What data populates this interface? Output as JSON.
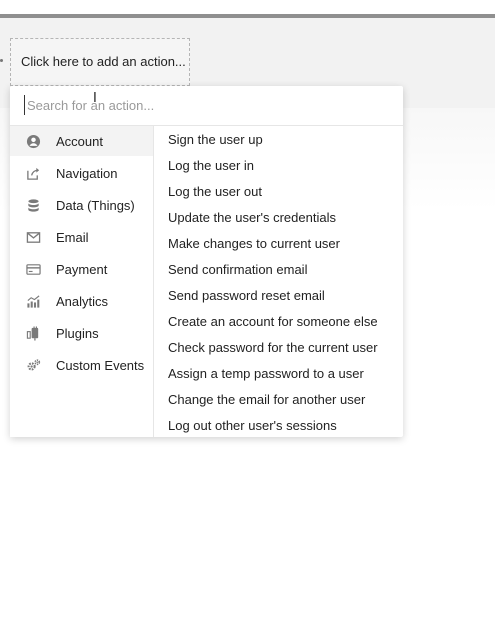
{
  "action_box": {
    "label": "Click here to add an action..."
  },
  "search": {
    "placeholder": "Search for an action...",
    "value": ""
  },
  "categories": [
    {
      "label": "Account",
      "icon": "account-icon",
      "active": true
    },
    {
      "label": "Navigation",
      "icon": "navigation-icon",
      "active": false
    },
    {
      "label": "Data (Things)",
      "icon": "database-icon",
      "active": false
    },
    {
      "label": "Email",
      "icon": "email-icon",
      "active": false
    },
    {
      "label": "Payment",
      "icon": "payment-icon",
      "active": false
    },
    {
      "label": "Analytics",
      "icon": "analytics-icon",
      "active": false
    },
    {
      "label": "Plugins",
      "icon": "plugins-icon",
      "active": false
    },
    {
      "label": "Custom Events",
      "icon": "custom-events-icon",
      "active": false
    }
  ],
  "actions": [
    "Sign the user up",
    "Log the user in",
    "Log the user out",
    "Update the user's credentials",
    "Make changes to current user",
    "Send confirmation email",
    "Send password reset email",
    "Create an account for someone else",
    "Check password for the current user",
    "Assign a temp password to a user",
    "Change the email for another user",
    "Log out other user's sessions"
  ],
  "colors": {
    "icon": "#777777",
    "active_bg": "#f3f3f3",
    "text": "#222222"
  }
}
